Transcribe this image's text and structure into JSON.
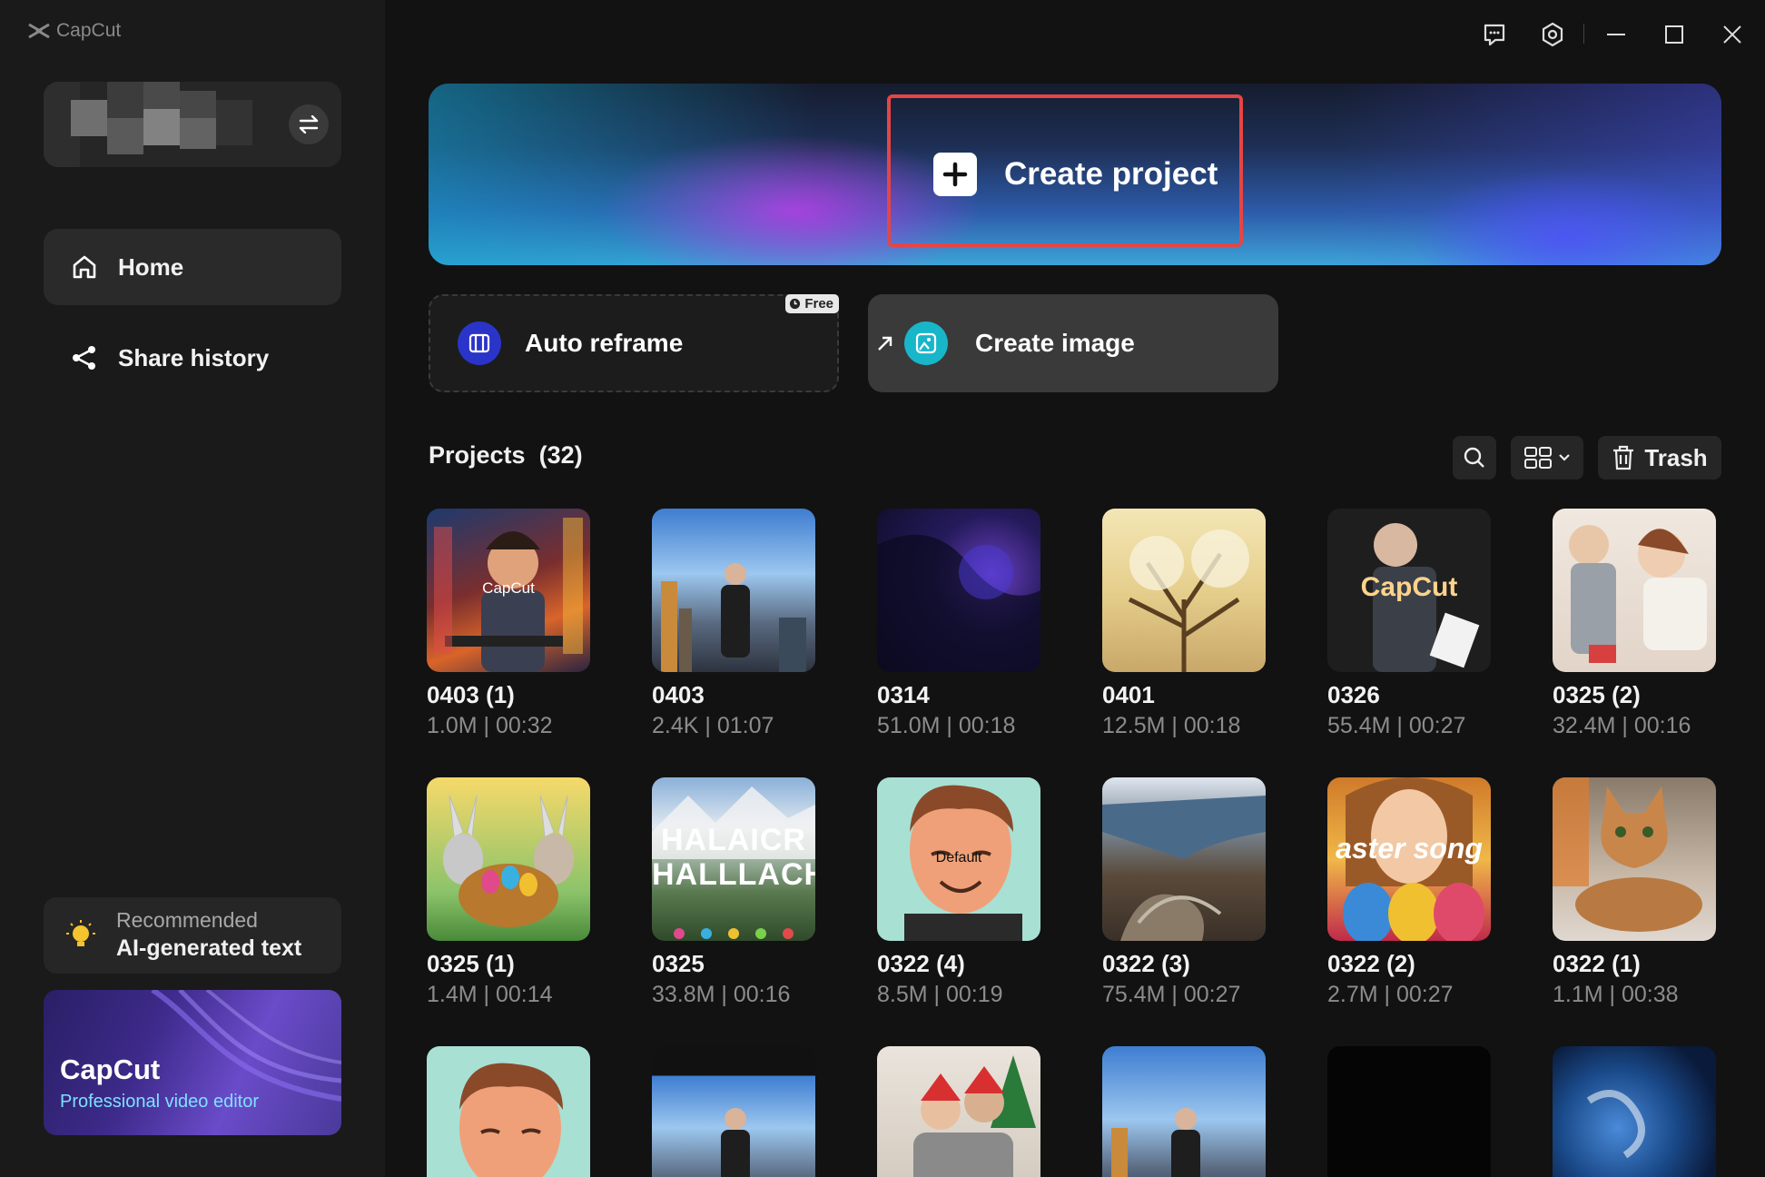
{
  "app": {
    "name": "CapCut"
  },
  "sidebar": {
    "nav": [
      {
        "label": "Home",
        "icon": "home-icon",
        "active": true
      },
      {
        "label": "Share history",
        "icon": "share-icon",
        "active": false
      }
    ],
    "recommend": {
      "caption": "Recommended",
      "title": "AI-generated text"
    },
    "promo": {
      "title": "CapCut",
      "subtitle": "Professional video editor"
    }
  },
  "banner": {
    "create_label": "Create project"
  },
  "tools": {
    "reframe": {
      "label": "Auto reframe",
      "badge": "Free"
    },
    "image": {
      "label": "Create image"
    }
  },
  "projects": {
    "title": "Projects",
    "count": "(32)",
    "trash_label": "Trash",
    "items": [
      {
        "name": "0403 (1)",
        "meta": "1.0M | 00:32",
        "overlay": "CapCut"
      },
      {
        "name": "0403",
        "meta": "2.4K | 01:07",
        "overlay": ""
      },
      {
        "name": "0314",
        "meta": "51.0M | 00:18",
        "overlay": ""
      },
      {
        "name": "0401",
        "meta": "12.5M | 00:18",
        "overlay": ""
      },
      {
        "name": "0326",
        "meta": "55.4M | 00:27",
        "overlay": "CapCut"
      },
      {
        "name": "0325 (2)",
        "meta": "32.4M | 00:16",
        "overlay": ""
      },
      {
        "name": "0325 (1)",
        "meta": "1.4M | 00:14",
        "overlay": ""
      },
      {
        "name": "0325",
        "meta": "33.8M | 00:16",
        "overlay": "HALAICR HALLLACH"
      },
      {
        "name": "0322 (4)",
        "meta": "8.5M | 00:19",
        "overlay": "Default"
      },
      {
        "name": "0322 (3)",
        "meta": "75.4M | 00:27",
        "overlay": ""
      },
      {
        "name": "0322 (2)",
        "meta": "2.7M | 00:27",
        "overlay": "aster song"
      },
      {
        "name": "0322 (1)",
        "meta": "1.1M | 00:38",
        "overlay": ""
      }
    ]
  },
  "colors": {
    "accent_red": "#e64545",
    "background": "#121212",
    "sidebar": "#1a1a1a"
  }
}
